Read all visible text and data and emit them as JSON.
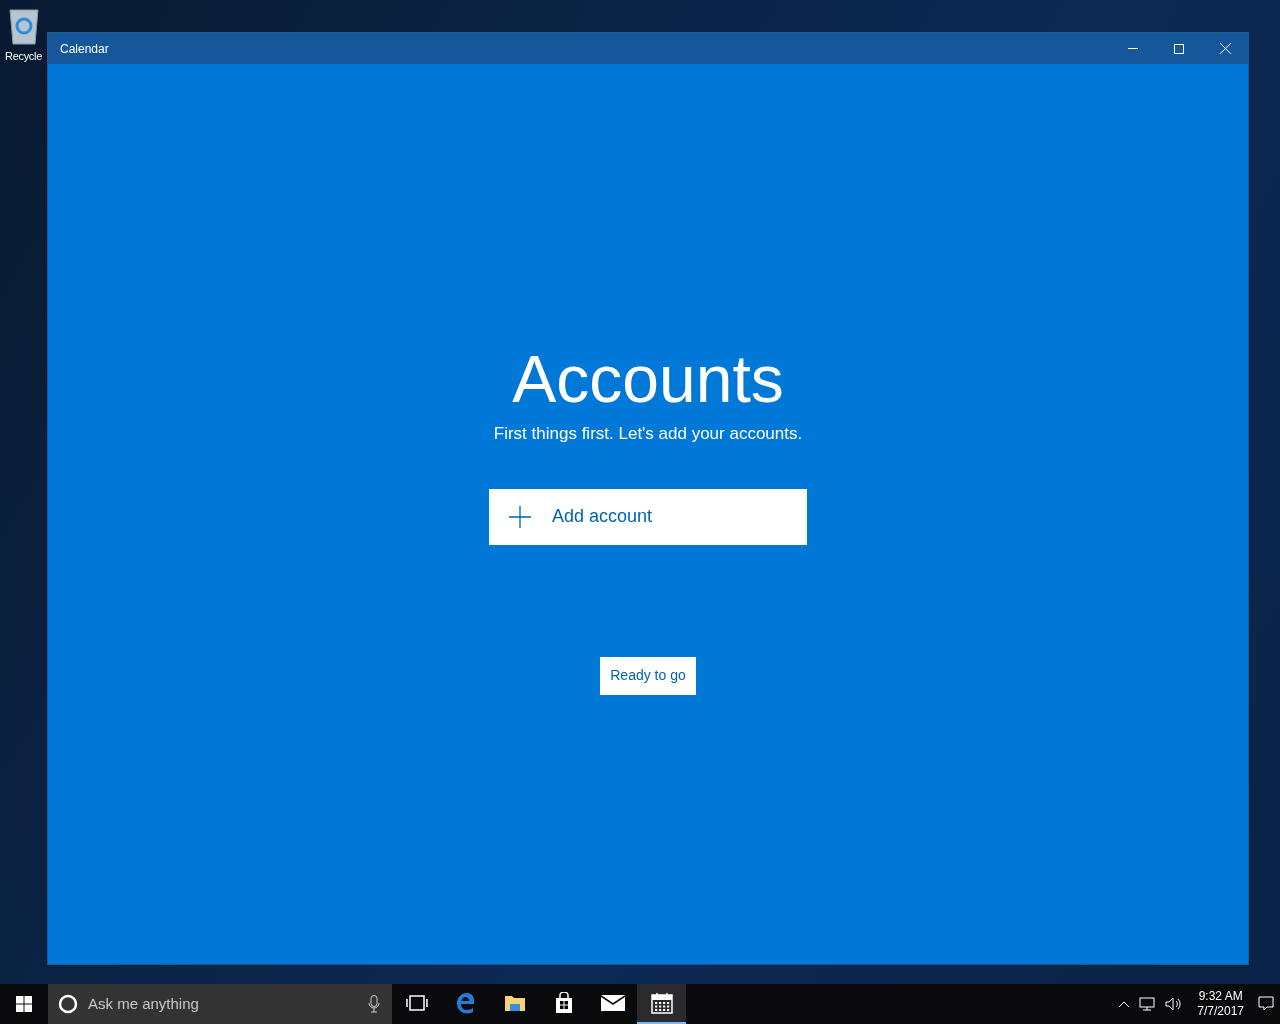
{
  "desktop": {
    "icons": [
      {
        "label": "Recycle"
      }
    ]
  },
  "window": {
    "title": "Calendar",
    "heading": "Accounts",
    "subtitle": "First things first. Let's add your accounts.",
    "add_button": "Add account",
    "ready_button": "Ready to go"
  },
  "taskbar": {
    "search": {
      "placeholder": "Ask me anything"
    },
    "apps": [
      {
        "kind": "task-view",
        "selected": false
      },
      {
        "kind": "edge",
        "selected": false
      },
      {
        "kind": "explorer",
        "selected": false
      },
      {
        "kind": "store",
        "selected": false
      },
      {
        "kind": "mail",
        "selected": false
      },
      {
        "kind": "calendar",
        "selected": true
      }
    ],
    "clock": {
      "time": "9:32 AM",
      "date": "7/7/2017"
    }
  }
}
